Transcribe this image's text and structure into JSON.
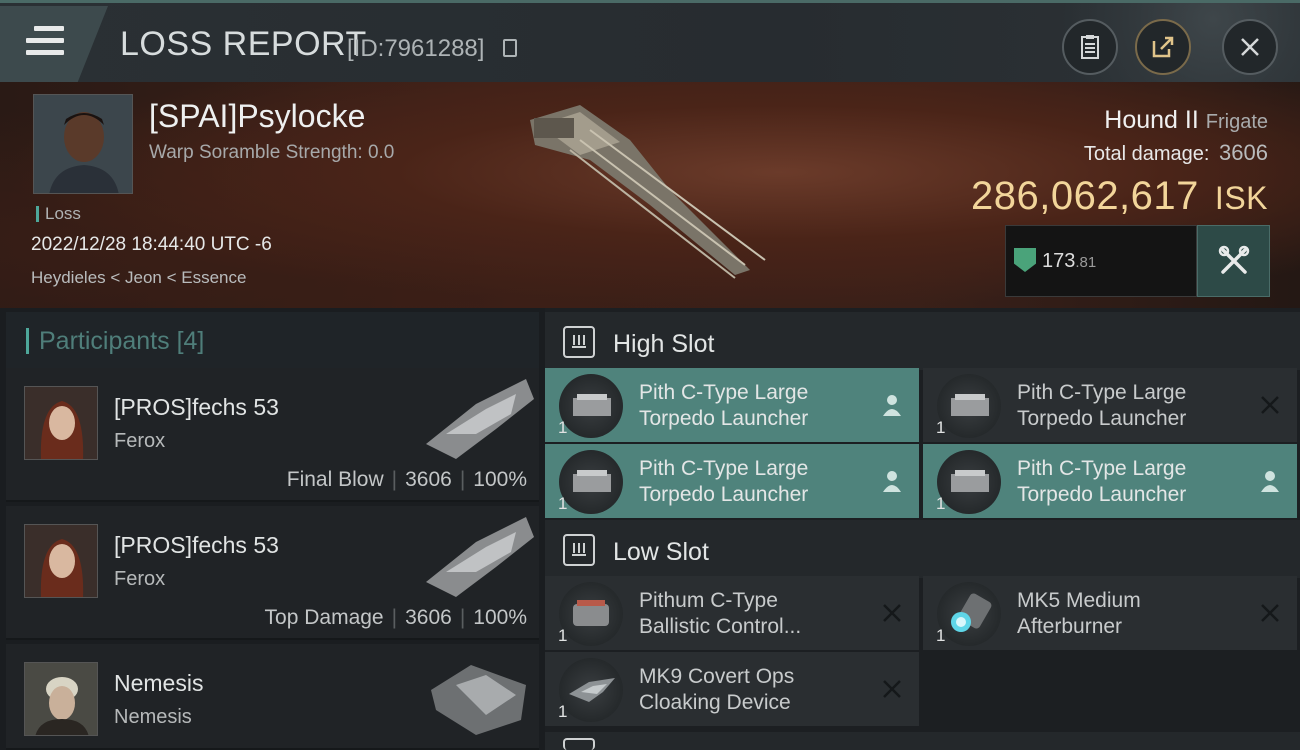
{
  "header": {
    "title": "LOSS REPORT",
    "report_id": "[ID:7961288]"
  },
  "victim": {
    "name": "[SPAI]Psylocke",
    "warp": "Warp Soramble Strength: 0.0",
    "tag": "Loss",
    "datetime": "2022/12/28 18:44:40 UTC -6",
    "location": "Heydieles < Jeon < Essence",
    "ship": "Hound II",
    "ship_class": "Frigate",
    "total_damage_label": "Total damage:",
    "total_damage": "3606",
    "isk_value": "286,062,617",
    "isk_unit": "ISK",
    "rating_main": "173",
    "rating_dec": ".81"
  },
  "participants": {
    "label": "Participants",
    "count": "[4]",
    "rows": [
      {
        "name": "[PROS]fechs 53",
        "ship": "Ferox",
        "stat_label": "Final Blow",
        "damage": "3606",
        "percent": "100%"
      },
      {
        "name": "[PROS]fechs 53",
        "ship": "Ferox",
        "stat_label": "Top Damage",
        "damage": "3606",
        "percent": "100%"
      },
      {
        "name": "Nemesis",
        "ship": "Nemesis",
        "stat_label": "",
        "damage": "",
        "percent": ""
      }
    ]
  },
  "slots": {
    "high": {
      "label": "High Slot",
      "modules": [
        {
          "line1": "Pith C-Type Large",
          "line2": "Torpedo Launcher",
          "qty": "1",
          "action": "person-icon",
          "active": true
        },
        {
          "line1": "Pith C-Type Large",
          "line2": "Torpedo Launcher",
          "qty": "1",
          "action": "close-icon",
          "active": false
        },
        {
          "line1": "Pith C-Type Large",
          "line2": "Torpedo Launcher",
          "qty": "1",
          "action": "person-icon",
          "active": true
        },
        {
          "line1": "Pith C-Type Large",
          "line2": "Torpedo Launcher",
          "qty": "1",
          "action": "person-icon",
          "active": true
        }
      ]
    },
    "low": {
      "label": "Low Slot",
      "modules": [
        {
          "line1": "Pithum C-Type",
          "line2": "Ballistic Control...",
          "qty": "1",
          "action": "close-icon",
          "active": false
        },
        {
          "line1": "MK5 Medium",
          "line2": "Afterburner",
          "qty": "1",
          "action": "close-icon",
          "active": false
        },
        {
          "line1": "MK9 Covert Ops",
          "line2": "Cloaking Device",
          "qty": "1",
          "action": "close-icon",
          "active": false
        }
      ]
    }
  },
  "colors": {
    "accent": "#4ea79a",
    "isk": "#f2d59a",
    "active_module": "#4f837c"
  }
}
